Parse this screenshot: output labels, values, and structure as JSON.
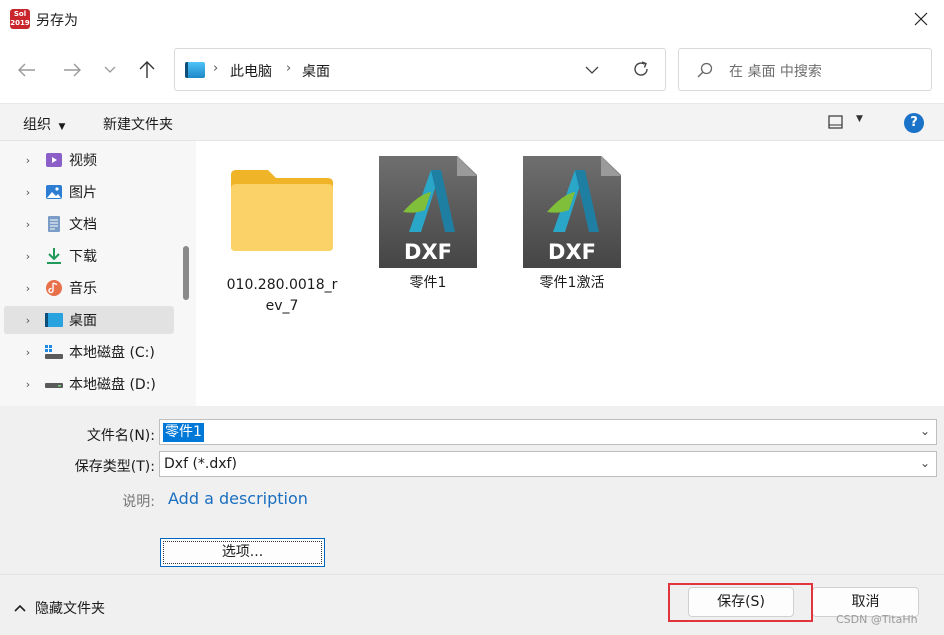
{
  "window": {
    "title": "另存为",
    "app_icon_text_top": "Sol",
    "app_icon_text_bottom": "2019"
  },
  "address": {
    "breadcrumbs": [
      "此电脑",
      "桌面"
    ],
    "search_placeholder": "在 桌面 中搜索"
  },
  "toolbar": {
    "organize_label": "组织",
    "new_folder_label": "新建文件夹"
  },
  "sidebar": {
    "items": [
      {
        "label": "视频",
        "icon": "video-icon"
      },
      {
        "label": "图片",
        "icon": "pictures-icon"
      },
      {
        "label": "文档",
        "icon": "documents-icon"
      },
      {
        "label": "下载",
        "icon": "downloads-icon"
      },
      {
        "label": "音乐",
        "icon": "music-icon"
      },
      {
        "label": "桌面",
        "icon": "desktop-icon",
        "selected": true
      },
      {
        "label": "本地磁盘 (C:)",
        "icon": "drive-icon"
      },
      {
        "label": "本地磁盘 (D:)",
        "icon": "drive-icon"
      }
    ]
  },
  "files": [
    {
      "name_line1": "010.280.0018_r",
      "name_line2": "ev_7",
      "type": "folder"
    },
    {
      "name_line1": "零件1",
      "type": "dxf",
      "badge": "DXF"
    },
    {
      "name_line1": "零件1激活",
      "type": "dxf",
      "badge": "DXF"
    }
  ],
  "form": {
    "filename_label": "文件名(N):",
    "filename_value": "零件1",
    "filetype_label": "保存类型(T):",
    "filetype_value": "Dxf (*.dxf)",
    "description_label": "说明:",
    "description_link": "Add a description",
    "options_button": "选项..."
  },
  "footer": {
    "hide_folders_label": "隐藏文件夹",
    "save_button": "保存(S)",
    "cancel_button": "取消",
    "watermark": "CSDN @TitaHh"
  },
  "colors": {
    "accent": "#0078d7",
    "highlight_box": "#e0353b",
    "folder": "#f6c84c"
  }
}
